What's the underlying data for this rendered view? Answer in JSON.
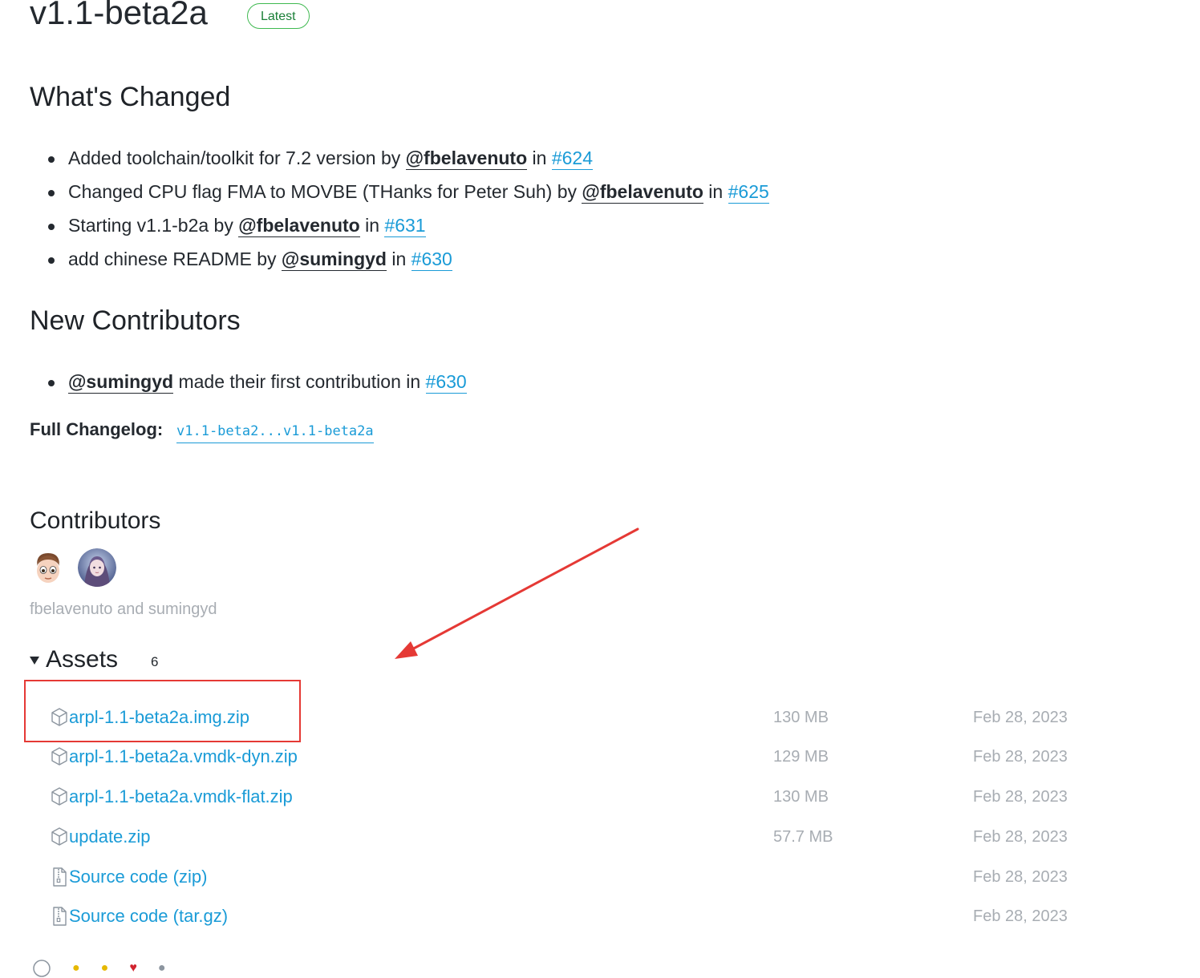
{
  "release": {
    "title": "v1.1-beta2a",
    "badge": "Latest"
  },
  "whats_changed": {
    "heading": "What's Changed",
    "items": [
      {
        "text": "Added toolchain/toolkit for 7.2 version by ",
        "user": "@fbelavenuto",
        "in": " in ",
        "pr": "#624"
      },
      {
        "text": "Changed CPU flag FMA to MOVBE (THanks for Peter Suh) by ",
        "user": "@fbelavenuto",
        "in": " in ",
        "pr": "#625"
      },
      {
        "text": "Starting v1.1-b2a by ",
        "user": "@fbelavenuto",
        "in": " in ",
        "pr": "#631"
      },
      {
        "text": "add chinese README by ",
        "user": "@sumingyd",
        "in": " in ",
        "pr": "#630"
      }
    ]
  },
  "new_contributors": {
    "heading": "New Contributors",
    "items": [
      {
        "user": "@sumingyd",
        "text": " made their first contribution in ",
        "pr": "#630"
      }
    ]
  },
  "changelog": {
    "label": "Full Changelog:",
    "link": "v1.1-beta2...v1.1-beta2a"
  },
  "contributors": {
    "heading": "Contributors",
    "names": "fbelavenuto and sumingyd"
  },
  "assets": {
    "heading": "Assets",
    "count": "6",
    "rows": [
      {
        "icon": "package-icon",
        "name": "arpl-1.1-beta2a.img.zip",
        "suffix": "",
        "size": "130 MB",
        "date": "Feb 28, 2023"
      },
      {
        "icon": "package-icon",
        "name": "arpl-1.1-beta2a.vmdk-dyn.zip",
        "suffix": "",
        "size": "129 MB",
        "date": "Feb 28, 2023"
      },
      {
        "icon": "package-icon",
        "name": "arpl-1.1-beta2a.vmdk-flat.zip",
        "suffix": "",
        "size": "130 MB",
        "date": "Feb 28, 2023"
      },
      {
        "icon": "package-icon",
        "name": "update.zip",
        "suffix": "",
        "size": "57.7 MB",
        "date": "Feb 28, 2023"
      },
      {
        "icon": "file-zip-icon",
        "name": "Source code",
        "suffix": " (zip)",
        "size": "",
        "date": "Feb 28, 2023"
      },
      {
        "icon": "file-zip-icon",
        "name": "Source code",
        "suffix": " (tar.gz)",
        "size": "",
        "date": "Feb 28, 2023"
      }
    ]
  },
  "colors": {
    "link": "#1a9bd7",
    "badge_border": "#3fb950",
    "annotation": "#e53935",
    "muted": "#a8adb3"
  }
}
